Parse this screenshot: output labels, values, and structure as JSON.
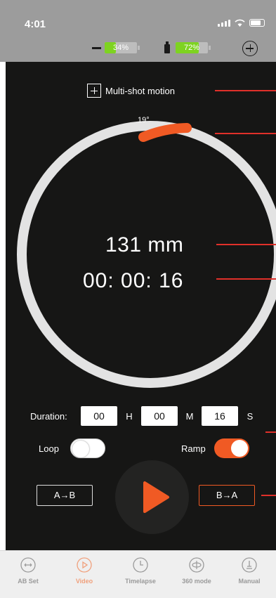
{
  "status_bar": {
    "time": "4:01"
  },
  "devices": {
    "battery_1": "34%",
    "battery_2": "72%"
  },
  "multi_shot": {
    "label": "Multi-shot motion"
  },
  "dial": {
    "angle": "19°",
    "distance": "131 mm",
    "time": "00: 00: 16",
    "arc_color": "#f05a24"
  },
  "duration": {
    "label": "Duration:",
    "hours": "00",
    "hours_unit": "H",
    "minutes": "00",
    "minutes_unit": "M",
    "seconds": "16",
    "seconds_unit": "S"
  },
  "toggles": {
    "loop_label": "Loop",
    "loop_on": false,
    "ramp_label": "Ramp",
    "ramp_on": true
  },
  "buttons": {
    "a_to_b": "A→B",
    "b_to_a": "B→A",
    "play_icon": "play-icon"
  },
  "tabbar": {
    "tabs": [
      {
        "label": "AB Set",
        "icon": "ab-set-icon",
        "active": false
      },
      {
        "label": "Video",
        "icon": "video-icon",
        "active": true
      },
      {
        "label": "Timelapse",
        "icon": "timelapse-icon",
        "active": false
      },
      {
        "label": "360 mode",
        "icon": "360-mode-icon",
        "active": false
      },
      {
        "label": "Manual",
        "icon": "manual-icon",
        "active": false
      }
    ]
  },
  "colors": {
    "accent": "#f05a24",
    "pointer_line": "#e0302a",
    "background": "#161615",
    "topbar": "#9c9c9c"
  }
}
